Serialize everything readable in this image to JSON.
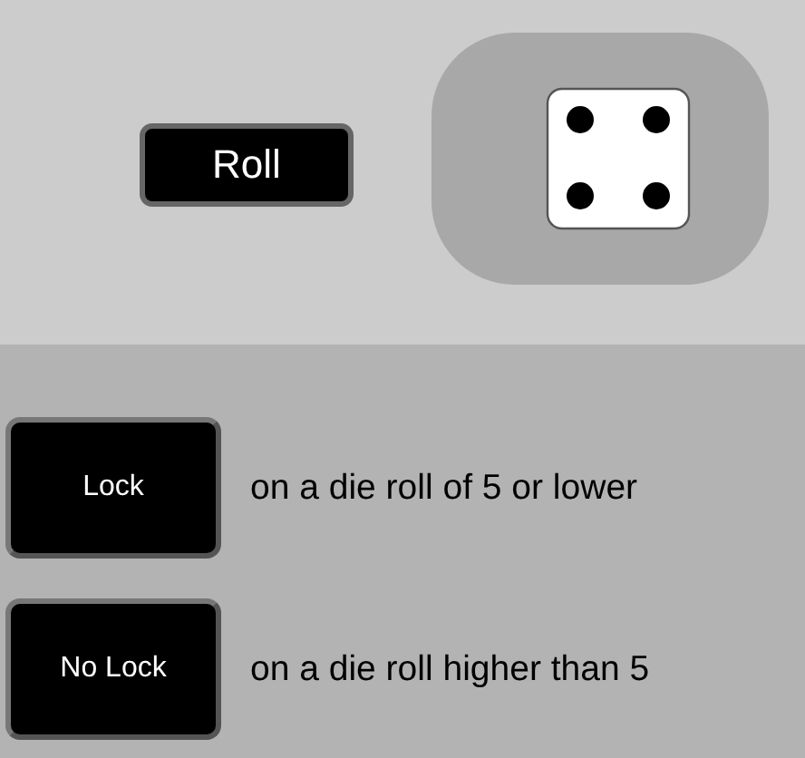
{
  "roll_button": {
    "label": "Roll"
  },
  "die": {
    "kind": "four"
  },
  "rules": [
    {
      "button": "Lock",
      "description": "on a die roll of 5 or lower"
    },
    {
      "button": "No Lock",
      "description": "on a die roll higher than 5"
    }
  ]
}
